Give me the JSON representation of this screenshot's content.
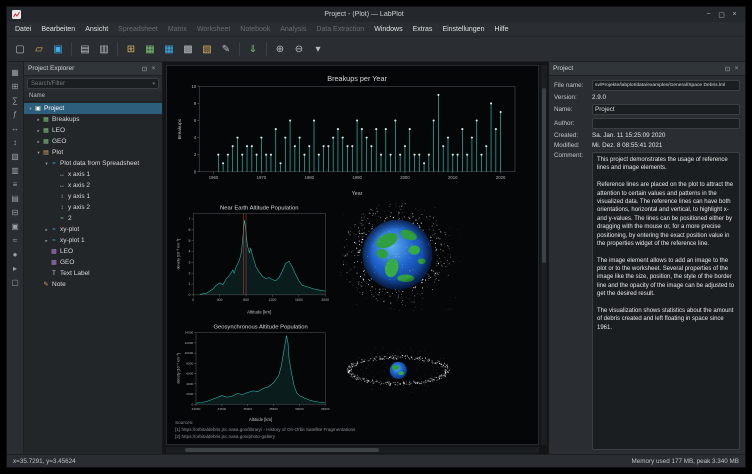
{
  "window": {
    "title": "Project - (Plot) — LabPlot"
  },
  "window_controls": [
    {
      "name": "minimize",
      "glyph": "−"
    },
    {
      "name": "maximize",
      "glyph": "▢"
    },
    {
      "name": "close",
      "glyph": "×"
    }
  ],
  "menubar": {
    "items": [
      {
        "label": "Datei",
        "enabled": true
      },
      {
        "label": "Bearbeiten",
        "enabled": true
      },
      {
        "label": "Ansicht",
        "enabled": true
      },
      {
        "label": "Spreadsheet",
        "enabled": false
      },
      {
        "label": "Matrix",
        "enabled": false
      },
      {
        "label": "Worksheet",
        "enabled": false
      },
      {
        "label": "Notebook",
        "enabled": false
      },
      {
        "label": "Analysis",
        "enabled": false
      },
      {
        "label": "Data Extraction",
        "enabled": false
      },
      {
        "label": "Windows",
        "enabled": true
      },
      {
        "label": "Extras",
        "enabled": true
      },
      {
        "label": "Einstellungen",
        "enabled": true
      },
      {
        "label": "Hilfe",
        "enabled": true
      }
    ]
  },
  "toolbar": {
    "buttons": [
      {
        "name": "new-project",
        "glyph": "▢",
        "color": "#b9bdbf"
      },
      {
        "name": "open-project",
        "glyph": "▱",
        "color": "#d8b15c"
      },
      {
        "name": "save-project",
        "glyph": "▣",
        "color": "#3daee9"
      },
      {
        "sep": true
      },
      {
        "name": "print",
        "glyph": "▤",
        "color": "#b9bdbf"
      },
      {
        "name": "print-preview",
        "glyph": "▥",
        "color": "#b9bdbf"
      },
      {
        "sep": true
      },
      {
        "name": "new-folder",
        "glyph": "⊞",
        "color": "#d8b15c"
      },
      {
        "name": "new-workbook",
        "glyph": "▦",
        "color": "#7bc275"
      },
      {
        "name": "new-spreadsheet",
        "glyph": "▦",
        "color": "#3daee9"
      },
      {
        "name": "new-matrix",
        "glyph": "▩",
        "color": "#b9bdbf"
      },
      {
        "name": "new-worksheet",
        "glyph": "▧",
        "color": "#d8b15c"
      },
      {
        "name": "new-note",
        "glyph": "✎",
        "color": "#b9bdbf"
      },
      {
        "sep": true
      },
      {
        "name": "import-file",
        "glyph": "⇓",
        "color": "#7bc275"
      },
      {
        "sep": true
      },
      {
        "name": "zoom-in",
        "glyph": "⊕",
        "color": "#b9bdbf"
      },
      {
        "name": "zoom-out",
        "glyph": "⊖",
        "color": "#b9bdbf"
      },
      {
        "name": "toolbar-overflow",
        "glyph": "▾",
        "color": "#b9bdbf"
      }
    ]
  },
  "dock_strip": {
    "icons": [
      {
        "name": "dock-icon-1",
        "glyph": "▦"
      },
      {
        "name": "dock-icon-2",
        "glyph": "⊞"
      },
      {
        "name": "dock-icon-3",
        "glyph": "∑"
      },
      {
        "name": "dock-icon-4",
        "glyph": "ƒ"
      },
      {
        "name": "dock-icon-5",
        "glyph": "↔"
      },
      {
        "name": "dock-icon-6",
        "glyph": "↕"
      },
      {
        "name": "dock-icon-7",
        "glyph": "▧"
      },
      {
        "name": "dock-icon-8",
        "glyph": "▥"
      },
      {
        "name": "dock-icon-9",
        "glyph": "≡"
      },
      {
        "name": "dock-icon-10",
        "glyph": "▤"
      },
      {
        "name": "dock-icon-11",
        "glyph": "⊟"
      },
      {
        "name": "dock-icon-12",
        "glyph": "▣"
      },
      {
        "name": "dock-icon-13",
        "glyph": "≈"
      },
      {
        "name": "dock-icon-14",
        "glyph": "●"
      },
      {
        "name": "dock-icon-15",
        "glyph": "▸"
      },
      {
        "name": "dock-icon-16",
        "glyph": "▢"
      }
    ]
  },
  "explorer": {
    "title": "Project Explorer",
    "search_placeholder": "Search/Filter",
    "column_header": "Name",
    "tree": [
      {
        "label": "Project",
        "depth": 0,
        "icon": "project",
        "arrow": "down",
        "selected": true
      },
      {
        "label": "Breakups",
        "depth": 1,
        "icon": "spreadsheet",
        "arrow": "right"
      },
      {
        "label": "LEO",
        "depth": 1,
        "icon": "spreadsheet",
        "arrow": "right"
      },
      {
        "label": "GEO",
        "depth": 1,
        "icon": "spreadsheet",
        "arrow": "right"
      },
      {
        "label": "Plot",
        "depth": 1,
        "icon": "worksheet",
        "arrow": "down"
      },
      {
        "label": "Plot data from Spreadsheet",
        "depth": 2,
        "icon": "plot",
        "arrow": "down"
      },
      {
        "label": "x axis 1",
        "depth": 3,
        "icon": "x-axis",
        "arrow": "none"
      },
      {
        "label": "x axis 2",
        "depth": 3,
        "icon": "x-axis",
        "arrow": "none"
      },
      {
        "label": "y axis 1",
        "depth": 3,
        "icon": "y-axis",
        "arrow": "none"
      },
      {
        "label": "y axis 2",
        "depth": 3,
        "icon": "y-axis",
        "arrow": "none"
      },
      {
        "label": "2",
        "depth": 3,
        "icon": "curve",
        "arrow": "none"
      },
      {
        "label": "xy-plot",
        "depth": 2,
        "icon": "plot",
        "arrow": "right"
      },
      {
        "label": "xy-plot 1",
        "depth": 2,
        "icon": "plot",
        "arrow": "right"
      },
      {
        "label": "LEO",
        "depth": 2,
        "icon": "image",
        "arrow": "none"
      },
      {
        "label": "GEO",
        "depth": 2,
        "icon": "image",
        "arrow": "none"
      },
      {
        "label": "Text Label",
        "depth": 2,
        "icon": "text",
        "arrow": "none"
      },
      {
        "label": "Note",
        "depth": 1,
        "icon": "note",
        "arrow": "none"
      }
    ]
  },
  "worksheet": {
    "sources": [
      "Sources:",
      "[1] https://orbitaldebris.jsc.nasa.gov/library/ - History of On-Orbit Satellite Fragmentations",
      "[2] https://orbitaldebris.jsc.nasa.gov/photo-gallery"
    ]
  },
  "properties": {
    "title": "Project",
    "file_name_label": "File name:",
    "file_name": "sv/Projekte/labplot/data/examples/General/Space Debris.lml",
    "version_label": "Version:",
    "version": "2.9.0",
    "name_label": "Name:",
    "name": "Project",
    "author_label": "Author:",
    "author": "",
    "created_label": "Created:",
    "created": "Sa. Jan. 11 15:25:09 2020",
    "modified_label": "Modified:",
    "modified": "Mi. Dez. 8 08:55:41 2021",
    "comment_label": "Comment:",
    "comment": "This project demonstrates the usage of reference lines and image elements.\n\nReference lines are placed on the plot to attract the attention to certain values and patterns in the visualized data. The reference lines can have both orientations, horizontal and vertical, to highlight x- and y-values. The lines can be positioned either by dragging with the mouse or, for a more precise positioning, by entering the exact position value in the properties widget of the reference line.\n\nThe image element allows to add an image to the plot or to the worksheet. Several properties of the image like the size, position, the style of the border line and the opacity of the image can be adjusted to get the desired result.\n\nThe visualization shows statistics about the amount of debris created and left floating in space since 1961."
  },
  "statusbar": {
    "left": "x=35.7291, y=3.45624",
    "right": "Memory used 177 MB, peak 3.340 MB"
  },
  "chart_data": [
    {
      "type": "stem",
      "title": "Breakups per Year",
      "xlabel": "Year",
      "ylabel": "Breakups",
      "xlim": [
        1957,
        2023
      ],
      "ylim": [
        0,
        10
      ],
      "xticks": [
        1960,
        1970,
        1980,
        1990,
        2000,
        2010,
        2020
      ],
      "yticks": [
        0,
        2,
        4,
        6,
        8,
        10
      ],
      "color": "#2ec0b4",
      "x": [
        1961,
        1962,
        1963,
        1964,
        1965,
        1966,
        1967,
        1968,
        1969,
        1970,
        1971,
        1972,
        1973,
        1974,
        1975,
        1976,
        1977,
        1978,
        1979,
        1980,
        1981,
        1982,
        1983,
        1984,
        1985,
        1986,
        1987,
        1988,
        1989,
        1990,
        1991,
        1992,
        1993,
        1994,
        1995,
        1996,
        1997,
        1998,
        1999,
        2000,
        2001,
        2002,
        2003,
        2004,
        2005,
        2006,
        2007,
        2008,
        2009,
        2010,
        2011,
        2012,
        2013,
        2014,
        2015,
        2016,
        2017,
        2018,
        2019,
        2020
      ],
      "values": [
        2,
        1,
        2,
        3,
        4,
        2,
        3,
        3,
        2,
        4,
        2,
        2,
        5,
        1,
        4,
        6,
        3,
        4,
        2,
        3,
        6,
        2,
        3,
        3,
        4,
        5,
        4,
        3,
        3,
        6,
        5,
        4,
        3,
        5,
        2,
        5,
        2,
        6,
        2,
        3,
        5,
        2,
        2,
        1,
        2,
        6,
        9,
        3,
        4,
        2,
        2,
        5,
        2,
        4,
        6,
        2,
        3,
        8,
        5,
        7
      ]
    },
    {
      "type": "line",
      "title": "Near Earth Altitude Population",
      "xlabel": "Altitude [km]",
      "ylabel": "density [10⁻⁸ km⁻³]",
      "xlim": [
        0,
        2000
      ],
      "ylim": [
        0,
        7.5
      ],
      "xticks": [
        0,
        400,
        800,
        1200,
        1600,
        2000
      ],
      "yticks": [
        0,
        1,
        2,
        3,
        4,
        5,
        6,
        7
      ],
      "color": "#2ec0b4",
      "reference_lines_x": [
        760,
        800
      ],
      "reference_color": "#e0483c",
      "x": [
        100,
        200,
        300,
        350,
        400,
        450,
        500,
        550,
        600,
        620,
        650,
        700,
        730,
        750,
        765,
        775,
        785,
        800,
        820,
        850,
        870,
        900,
        950,
        1000,
        1050,
        1100,
        1150,
        1200,
        1250,
        1300,
        1350,
        1400,
        1450,
        1500,
        1550,
        1600,
        1650,
        1700,
        1750,
        1800,
        1850,
        1900,
        1950,
        2000
      ],
      "y": [
        0.05,
        0.15,
        0.55,
        0.9,
        1.1,
        0.95,
        1.5,
        1.8,
        2.3,
        2.0,
        2.6,
        3.2,
        4.0,
        5.2,
        6.3,
        6.9,
        6.5,
        5.8,
        4.6,
        3.9,
        4.3,
        3.6,
        2.6,
        2.1,
        1.7,
        1.5,
        1.6,
        1.4,
        1.3,
        1.6,
        2.2,
        2.9,
        3.1,
        2.6,
        1.9,
        1.3,
        0.9,
        0.8,
        0.7,
        0.6,
        0.5,
        0.45,
        0.4,
        0.35
      ]
    },
    {
      "type": "line",
      "title": "Geosynchronous Altitude Population",
      "xlabel": "Altitude [km]",
      "ylabel": "density [10⁻⁹ km⁻³]",
      "xlim": [
        34000,
        36500
      ],
      "ylim": [
        0,
        14000
      ],
      "xticks": [
        34000,
        34500,
        35000,
        35500,
        36000,
        36500
      ],
      "yticks": [
        0,
        2000,
        4000,
        6000,
        8000,
        10000,
        12000,
        14000
      ],
      "color": "#2ec0b4",
      "x": [
        34000,
        34100,
        34200,
        34300,
        34400,
        34500,
        34600,
        34700,
        34800,
        34900,
        35000,
        35100,
        35200,
        35300,
        35400,
        35500,
        35600,
        35650,
        35700,
        35750,
        35780,
        35800,
        35850,
        35900,
        35950,
        36000,
        36100,
        36200,
        36300,
        36400,
        36500
      ],
      "y": [
        250,
        350,
        500,
        900,
        1300,
        1700,
        1400,
        1600,
        2100,
        1900,
        2300,
        2600,
        2500,
        3100,
        3400,
        4200,
        5600,
        7500,
        10500,
        13400,
        12000,
        9000,
        6000,
        3500,
        2200,
        1700,
        1200,
        800,
        550,
        380,
        300
      ]
    }
  ],
  "colors": {
    "highlight": "#3daee9",
    "curve": "#2ec0b4",
    "reference": "#e0483c"
  }
}
